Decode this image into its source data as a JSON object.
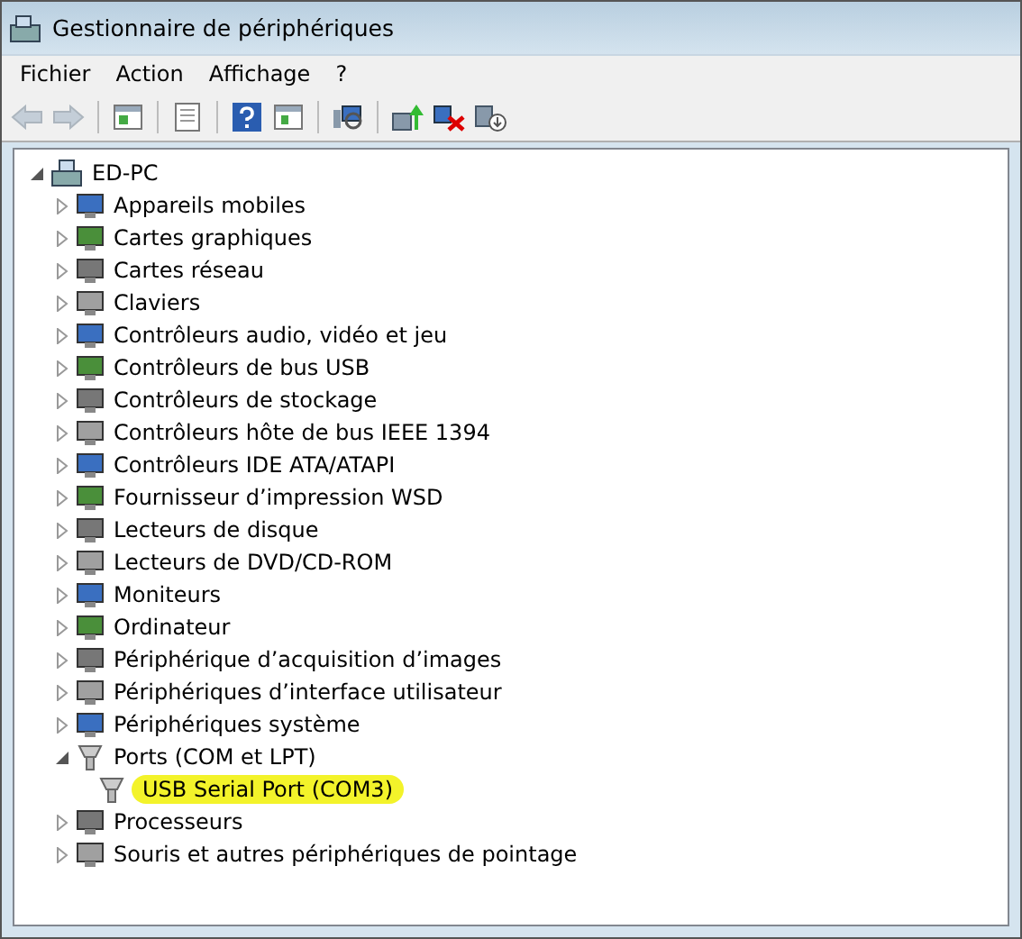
{
  "window": {
    "title": "Gestionnaire de périphériques"
  },
  "menu": [
    {
      "label": "Fichier"
    },
    {
      "label": "Action"
    },
    {
      "label": "Affichage"
    },
    {
      "label": "?"
    }
  ],
  "toolbar": [
    {
      "kind": "back",
      "disabled": true
    },
    {
      "kind": "forward",
      "disabled": true
    },
    {
      "kind": "separator"
    },
    {
      "kind": "console",
      "disabled": false
    },
    {
      "kind": "separator"
    },
    {
      "kind": "properties",
      "disabled": false
    },
    {
      "kind": "separator"
    },
    {
      "kind": "help",
      "disabled": false
    },
    {
      "kind": "panel",
      "disabled": false
    },
    {
      "kind": "separator"
    },
    {
      "kind": "scan",
      "disabled": false
    },
    {
      "kind": "separator"
    },
    {
      "kind": "update",
      "disabled": false
    },
    {
      "kind": "uninstall",
      "disabled": false
    },
    {
      "kind": "disable",
      "disabled": false
    }
  ],
  "tree": {
    "label": "ED-PC",
    "expanded": true,
    "children": [
      {
        "label": "Appareils mobiles",
        "expanded": false
      },
      {
        "label": "Cartes graphiques",
        "expanded": false
      },
      {
        "label": "Cartes réseau",
        "expanded": false
      },
      {
        "label": "Claviers",
        "expanded": false
      },
      {
        "label": "Contrôleurs audio, vidéo et jeu",
        "expanded": false
      },
      {
        "label": "Contrôleurs de bus USB",
        "expanded": false
      },
      {
        "label": "Contrôleurs de stockage",
        "expanded": false
      },
      {
        "label": "Contrôleurs hôte de bus IEEE 1394",
        "expanded": false
      },
      {
        "label": "Contrôleurs IDE ATA/ATAPI",
        "expanded": false
      },
      {
        "label": "Fournisseur d’impression WSD",
        "expanded": false
      },
      {
        "label": "Lecteurs de disque",
        "expanded": false
      },
      {
        "label": "Lecteurs de DVD/CD-ROM",
        "expanded": false
      },
      {
        "label": "Moniteurs",
        "expanded": false
      },
      {
        "label": "Ordinateur",
        "expanded": false
      },
      {
        "label": "Périphérique d’acquisition d’images",
        "expanded": false
      },
      {
        "label": "Périphériques d’interface utilisateur",
        "expanded": false
      },
      {
        "label": "Périphériques système",
        "expanded": false
      },
      {
        "label": "Ports (COM et LPT)",
        "expanded": true,
        "children": [
          {
            "label": "USB Serial Port (COM3)",
            "highlighted": true
          }
        ]
      },
      {
        "label": "Processeurs",
        "expanded": false
      },
      {
        "label": "Souris et autres périphériques de pointage",
        "expanded": false
      }
    ]
  }
}
